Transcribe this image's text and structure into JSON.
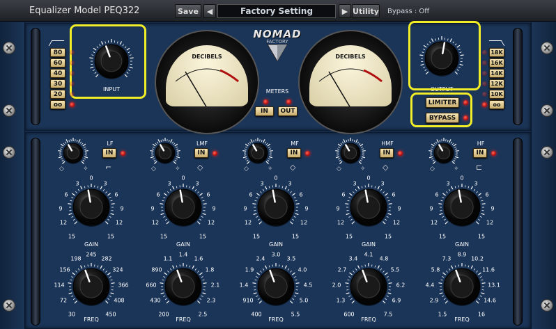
{
  "header": {
    "title": "Equalizer Model PEQ322",
    "save_label": "Save",
    "preset_name": "Factory Setting",
    "utility_label": "Utility",
    "bypass_status": "Bypass : Off"
  },
  "brand": {
    "name": "NOMAD",
    "sub": "FACTORY"
  },
  "input_section": {
    "label": "INPUT",
    "hp_buttons": [
      "80",
      "60",
      "40",
      "30",
      "20",
      "oo"
    ]
  },
  "output_section": {
    "label": "OUTPUT",
    "lp_buttons": [
      "18K",
      "16K",
      "14K",
      "12K",
      "10K",
      "oo"
    ],
    "limiter_label": "LIMITER",
    "bypass_label": "BYPASS"
  },
  "meters": {
    "title": "METERS",
    "in_label": "IN",
    "out_label": "OUT",
    "face_title": "DECIBELS"
  },
  "gain_scale": [
    "0",
    "3",
    "3",
    "6",
    "6",
    "9",
    "9",
    "12",
    "12",
    "15",
    "15"
  ],
  "bands": [
    {
      "name": "LF",
      "in_label": "IN",
      "gain_label": "GAIN",
      "freq_label": "FREQ",
      "freq_ticks": [
        "245",
        "198",
        "282",
        "156",
        "324",
        "114",
        "366",
        "72",
        "408",
        "30",
        "450"
      ]
    },
    {
      "name": "LMF",
      "in_label": "IN",
      "gain_label": "GAIN",
      "freq_label": "FREQ",
      "freq_ticks": [
        "1.4",
        "1.1",
        "1.6",
        "890",
        "1.8",
        "660",
        "2.1",
        "430",
        "2.3",
        "200",
        "2.5"
      ]
    },
    {
      "name": "MF",
      "in_label": "IN",
      "gain_label": "GAIN",
      "freq_label": "FREQ",
      "freq_ticks": [
        "3.0",
        "2.4",
        "3.5",
        "1.9",
        "4.0",
        "1.4",
        "4.5",
        "910",
        "5.0",
        "400",
        "5.5"
      ]
    },
    {
      "name": "HMF",
      "in_label": "IN",
      "gain_label": "GAIN",
      "freq_label": "FREQ",
      "freq_ticks": [
        "4.1",
        "3.4",
        "4.8",
        "2.7",
        "5.5",
        "2.0",
        "6.2",
        "1.3",
        "6.9",
        "600",
        "7.5"
      ]
    },
    {
      "name": "HF",
      "in_label": "IN",
      "gain_label": "GAIN",
      "freq_label": "FREQ",
      "freq_ticks": [
        "8.9",
        "7.3",
        "10.2",
        "5.8",
        "11.6",
        "4.4",
        "13.1",
        "2.9",
        "14.6",
        "1.5",
        "16"
      ]
    }
  ],
  "colors": {
    "panel": "#1b3558",
    "button": "#e9d59c",
    "led": "#e02020",
    "highlight": "#f1ee28"
  }
}
